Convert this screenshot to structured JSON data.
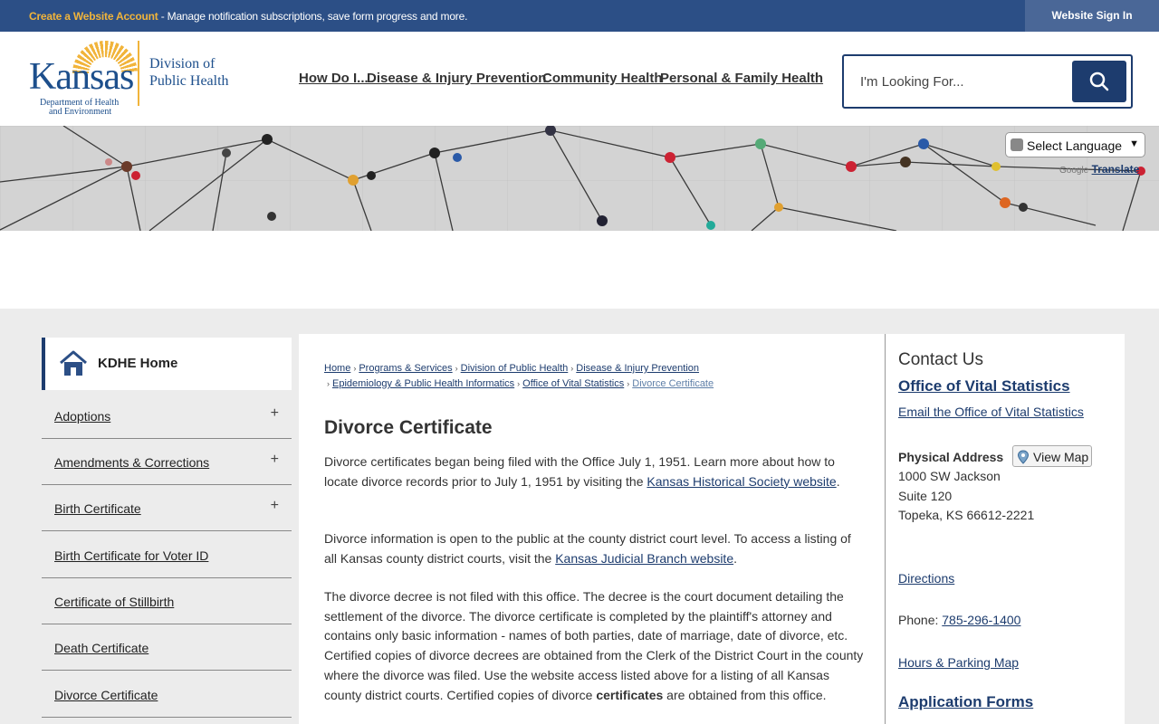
{
  "topbar": {
    "promo_link": "Create a Website Account",
    "promo_text": " - Manage notification subscriptions, save form progress and more.",
    "signin": "Website Sign In"
  },
  "logo": {
    "brand": "Kansas",
    "sub1": "Department of Health",
    "sub2": "and Environment",
    "division1": "Division of",
    "division2": "Public Health",
    "accent_color": "#f1b43b",
    "brand_color": "#1d4f8c"
  },
  "nav": [
    "How Do I...",
    "Disease & Injury Prevention",
    "Community Health",
    "Personal & Family Health"
  ],
  "search": {
    "placeholder": "I'm Looking For...",
    "icon": "search-icon"
  },
  "translate": {
    "select_label": "Select Language",
    "powered_by": "Google",
    "translate": "Translate"
  },
  "sidebar": {
    "home": "KDHE Home",
    "items": [
      {
        "label": "Adoptions",
        "expand": "+"
      },
      {
        "label": "Amendments & Corrections",
        "expand": "+"
      },
      {
        "label": "Birth Certificate",
        "expand": "+"
      },
      {
        "label": "Birth Certificate for Voter ID",
        "expand": ""
      },
      {
        "label": "Certificate of Stillbirth",
        "expand": ""
      },
      {
        "label": "Death Certificate",
        "expand": ""
      },
      {
        "label": "Divorce Certificate",
        "expand": ""
      }
    ]
  },
  "breadcrumbs": {
    "items": [
      "Home",
      "Programs & Services",
      "Division of Public Health",
      "Disease & Injury Prevention",
      "Epidemiology & Public Health Informatics",
      "Office of Vital Statistics"
    ],
    "current": "Divorce Certificate",
    "separator": "›"
  },
  "main": {
    "title": "Divorce Certificate",
    "p1_text": "Divorce certificates began being filed with the Office July 1, 1951. Learn more about how to locate divorce records prior to July 1, 1951 by visiting the ",
    "p1_link": "Kansas Historical Society website",
    "p1_end": ".",
    "p2_text": "Divorce information is open to the public at the county district court level. To access a listing of all Kansas county district courts, visit the ",
    "p2_link": "Kansas Judicial Branch website",
    "p2_end": ".",
    "p3_text": "The divorce decree is not filed with this office. The decree is the court document detailing the settlement of the divorce. The divorce certificate is completed by the plaintiff's attorney and contains only basic information - names of both parties, date of marriage, date of divorce, etc. Certified copies of divorce decrees are obtained from the Clerk of the District Court in the county where the divorce was filed. Use the website access listed above for a listing of all Kansas county district courts. Certified copies of divorce ",
    "p3_bold": "certificates",
    "p3_end": " are obtained from this office."
  },
  "contact": {
    "heading": "Contact Us",
    "office": "Office of Vital Statistics",
    "email": "Email the Office of Vital Statistics",
    "address_label": "Physical Address",
    "view_map": "View Map",
    "address1": "1000 SW Jackson",
    "address2": "Suite 120",
    "address3": "Topeka, KS 66612-2221",
    "directions": "Directions",
    "phone_label": "Phone: ",
    "phone": "785-296-1400",
    "hours": "Hours & Parking Map",
    "forms": "Application Forms"
  }
}
